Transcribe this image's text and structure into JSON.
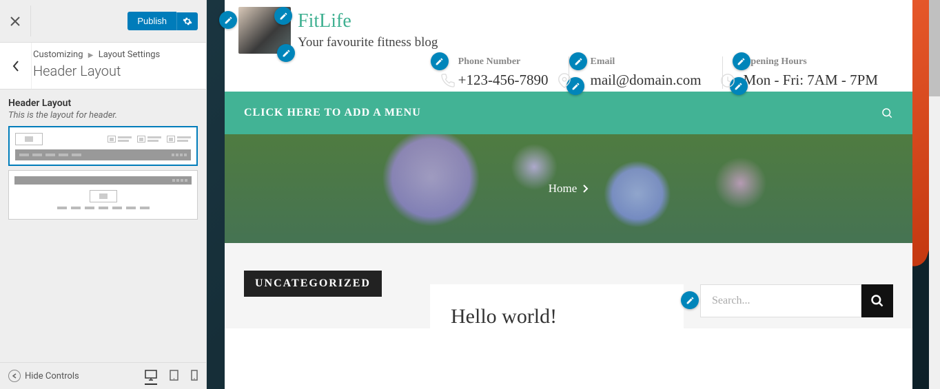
{
  "sidebar": {
    "publish_label": "Publish",
    "breadcrumb_root": "Customizing",
    "breadcrumb_current": "Layout Settings",
    "panel_title": "Header Layout",
    "section_label": "Header Layout",
    "section_desc": "This is the layout for header.",
    "hide_controls_label": "Hide Controls"
  },
  "site": {
    "brand_name": "FitLife",
    "brand_tagline": "Your favourite fitness blog",
    "info": [
      {
        "label": "Phone Number",
        "value": "+123-456-7890"
      },
      {
        "label": "Email",
        "value": "mail@domain.com"
      },
      {
        "label": "Opening Hours",
        "value": "Mon - Fri: 7AM - 7PM"
      }
    ],
    "menu_prompt": "CLICK HERE TO ADD A MENU",
    "hero_crumb": "Home",
    "category_badge": "UNCATEGORIZED",
    "post_title": "Hello world!",
    "search_placeholder": "Search..."
  },
  "colors": {
    "accent": "#007cba",
    "brand_green": "#42b395"
  }
}
